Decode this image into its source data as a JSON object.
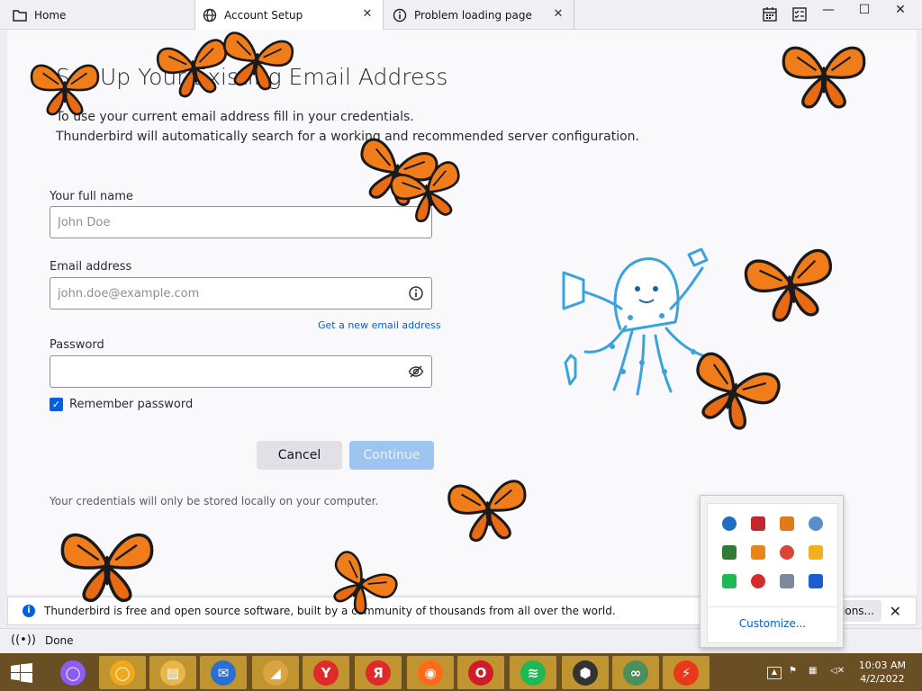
{
  "tabs": [
    {
      "label": "Home"
    },
    {
      "label": "Account Setup"
    },
    {
      "label": "Problem loading page"
    }
  ],
  "window_controls": {
    "minimize": "—",
    "maximize": "☐",
    "close": "✕"
  },
  "page": {
    "title": "Set Up Your Existing Email Address",
    "intro_line1": "To use your current email address fill in your credentials.",
    "intro_line2": "Thunderbird will automatically search for a working and recommended server configuration."
  },
  "form": {
    "name_label": "Your full name",
    "name_placeholder": "John Doe",
    "email_label": "Email address",
    "email_placeholder": "john.doe@example.com",
    "new_email_link": "Get a new email address",
    "password_label": "Password",
    "remember_label": "Remember password",
    "remember_checked": true,
    "cancel_label": "Cancel",
    "continue_label": "Continue",
    "footnote": "Your credentials will only be stored locally on your computer."
  },
  "notification": {
    "text": "Thunderbird is free and open source software, built by a community of thousands from all over the world.",
    "button_label": "Options..."
  },
  "status": {
    "text": "Done"
  },
  "tray_popup": {
    "icons": [
      {
        "name": "blue-swirl-icon",
        "color": "#1e6fc2"
      },
      {
        "name": "shield-red-icon",
        "color": "#c0282d"
      },
      {
        "name": "butterfly-icon",
        "color": "#e07b1a"
      },
      {
        "name": "disk-cleanup-icon",
        "color": "#5b8fc9"
      },
      {
        "name": "green-grid-icon",
        "color": "#2e7d32"
      },
      {
        "name": "magnifier-icon",
        "color": "#e8851a"
      },
      {
        "name": "chrome-icon",
        "color": "#db4437"
      },
      {
        "name": "lightning-icon",
        "color": "#f2b01e"
      },
      {
        "name": "spotify-icon",
        "color": "#1db954"
      },
      {
        "name": "yandex-icon",
        "color": "#d42b2b"
      },
      {
        "name": "printer-icon",
        "color": "#7d8a99"
      },
      {
        "name": "malwarebytes-icon",
        "color": "#1a5fd1"
      }
    ],
    "customize_label": "Customize..."
  },
  "taskbar": {
    "apps": [
      {
        "name": "alice-icon",
        "glyph": "◯",
        "color": "#8b5cf6"
      },
      {
        "name": "yellow-circle-icon",
        "glyph": "◯",
        "color": "#f2a81d"
      },
      {
        "name": "file-explorer-icon",
        "glyph": "▤",
        "color": "#e8b64c"
      },
      {
        "name": "thunderbird-icon",
        "glyph": "✉",
        "color": "#2d6fd1"
      },
      {
        "name": "megaphone-icon",
        "glyph": "◢",
        "color": "#d9a441"
      },
      {
        "name": "yandex-browser-icon",
        "glyph": "Y",
        "color": "#e02a2a"
      },
      {
        "name": "yandex-icon",
        "glyph": "Я",
        "color": "#e02a2a"
      },
      {
        "name": "firefox-icon",
        "glyph": "◉",
        "color": "#ff6a1a"
      },
      {
        "name": "opera-icon",
        "glyph": "O",
        "color": "#d11a2a"
      },
      {
        "name": "spotify-icon",
        "glyph": "≋",
        "color": "#1db954"
      },
      {
        "name": "shield-app-icon",
        "glyph": "⬢",
        "color": "#333333"
      },
      {
        "name": "link-app-icon",
        "glyph": "∞",
        "color": "#4a8f5c"
      },
      {
        "name": "lightning-app-icon",
        "glyph": "⚡",
        "color": "#e83a1a"
      }
    ],
    "clock_time": "10:03 AM",
    "clock_date": "4/2/2022"
  }
}
